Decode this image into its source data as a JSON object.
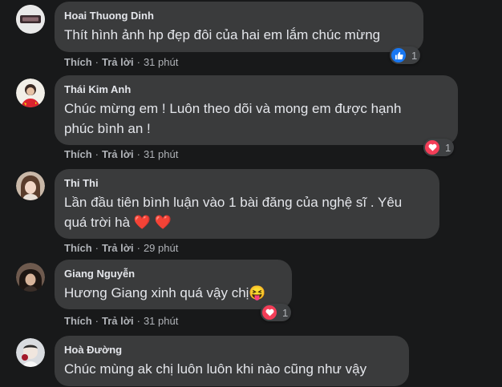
{
  "comments": [
    {
      "name": "Hoai Thuong Dinh",
      "text": "Thít hình ảnh hp đẹp đôi của hai em lắm chúc mừng",
      "like": "Thích",
      "reply": "Trả lời",
      "time": "31 phút",
      "reaction": {
        "icon": "like-icon",
        "color": "#1877f2",
        "count": "1"
      }
    },
    {
      "name": "Thái Kim Anh",
      "text": "Chúc mừng em ! Luôn theo dõi và mong em được hạnh\nphúc bình an !",
      "like": "Thích",
      "reply": "Trả lời",
      "time": "31 phút",
      "reaction": {
        "icon": "heart-icon",
        "color": "#f33e58",
        "count": "1"
      }
    },
    {
      "name": "Thi Thi",
      "text": "Lần đầu tiên bình luận vào 1 bài đăng của nghệ sĩ . Yêu\nquá trời hà ❤️ ❤️",
      "like": "Thích",
      "reply": "Trả lời",
      "time": "29 phút"
    },
    {
      "name": "Giang Nguyễn",
      "text": "Hương Giang xinh quá vậy chị😝",
      "like": "Thích",
      "reply": "Trả lời",
      "time": "31 phút",
      "reaction": {
        "icon": "heart-icon",
        "color": "#f33e58",
        "count": "1"
      }
    },
    {
      "name": "Hoà Đường",
      "text": "Chúc mùng ak chị luôn luôn khi nào cũng như vậy"
    }
  ]
}
